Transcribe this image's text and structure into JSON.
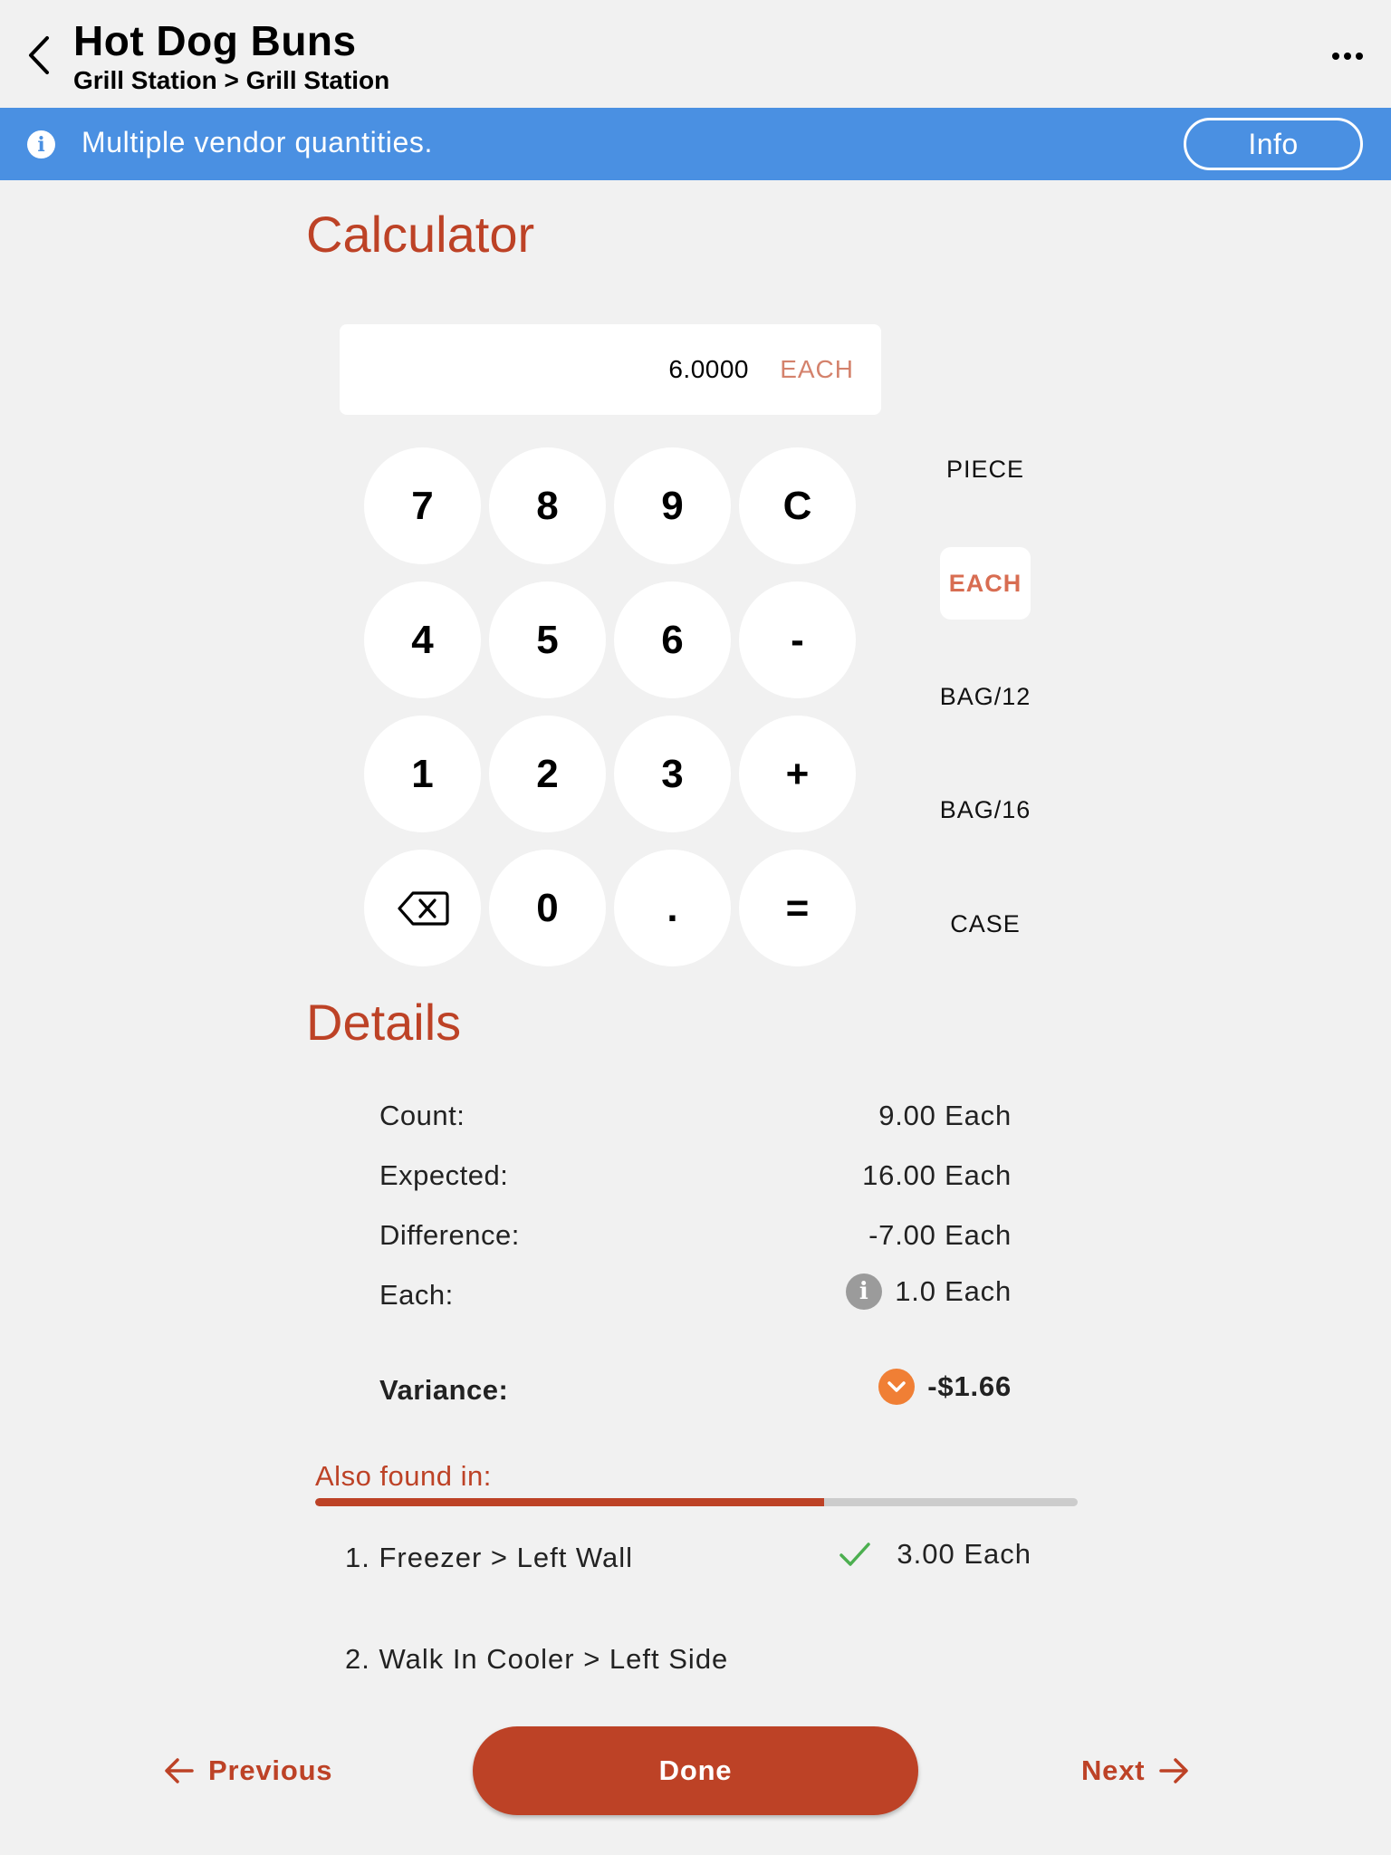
{
  "header": {
    "title": "Hot Dog Buns",
    "breadcrumb": "Grill Station > Grill Station",
    "back_icon": "chevron-left-icon",
    "more_icon": "ellipsis-icon"
  },
  "banner": {
    "message": "Multiple vendor quantities.",
    "icon": "info-icon",
    "info_button": "Info",
    "color": "#4a90e2"
  },
  "calculator": {
    "title": "Calculator",
    "display_value": "6.0000",
    "display_unit": "EACH",
    "keys": [
      "7",
      "8",
      "9",
      "C",
      "4",
      "5",
      "6",
      "-",
      "1",
      "2",
      "3",
      "+",
      "backspace",
      "0",
      ".",
      "="
    ],
    "units": [
      {
        "label": "PIECE",
        "selected": false
      },
      {
        "label": "EACH",
        "selected": true
      },
      {
        "label": "BAG/12",
        "selected": false
      },
      {
        "label": "BAG/16",
        "selected": false
      },
      {
        "label": "CASE",
        "selected": false
      }
    ]
  },
  "details": {
    "title": "Details",
    "rows": [
      {
        "label": "Count:",
        "value": "9.00 Each"
      },
      {
        "label": "Expected:",
        "value": "16.00 Each"
      },
      {
        "label": "Difference:",
        "value": "-7.00 Each"
      },
      {
        "label": "Each:",
        "value": "1.0 Each"
      }
    ],
    "variance_label": "Variance:",
    "variance_value": "-$1.66"
  },
  "also_found": {
    "label": "Also found in:",
    "progress": 0.667,
    "locations": [
      {
        "name": "1. Freezer > Left Wall",
        "value": "3.00 Each",
        "checked": true
      },
      {
        "name": "2. Walk In Cooler > Left Side",
        "value": "",
        "checked": false
      }
    ]
  },
  "footer": {
    "previous": "Previous",
    "done": "Done",
    "next": "Next"
  },
  "colors": {
    "accent": "#bd4226",
    "selected_unit": "#d86d52",
    "variance_icon": "#f07f35",
    "check": "#4caf50"
  }
}
